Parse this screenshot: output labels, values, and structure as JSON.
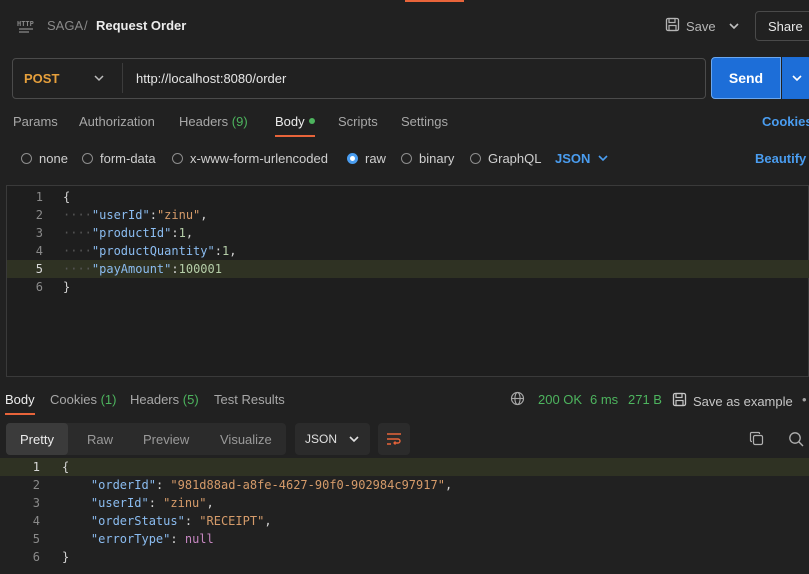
{
  "header": {
    "breadcrumb_parent": "SAGA",
    "breadcrumb_sep": "/",
    "title": "Request Order",
    "save_label": "Save",
    "share_label": "Share"
  },
  "request": {
    "method": "POST",
    "url": "http://localhost:8080/order",
    "send_label": "Send"
  },
  "request_tabs": {
    "params": "Params",
    "authorization": "Authorization",
    "headers": "Headers",
    "headers_count": "(9)",
    "body": "Body",
    "scripts": "Scripts",
    "settings": "Settings",
    "cookies": "Cookies"
  },
  "body_types": {
    "none": "none",
    "form_data": "form-data",
    "urlencoded": "x-www-form-urlencoded",
    "raw": "raw",
    "binary": "binary",
    "graphql": "GraphQL",
    "format": "JSON",
    "beautify": "Beautify",
    "selected": "raw"
  },
  "request_body": {
    "line_numbers": [
      "1",
      "2",
      "3",
      "4",
      "5",
      "6"
    ],
    "key_userId": "\"userId\"",
    "val_userId": "\"zinu\"",
    "key_productId": "\"productId\"",
    "val_productId": "1",
    "key_productQuantity": "\"productQuantity\"",
    "val_productQuantity": "1",
    "key_payAmount": "\"payAmount\"",
    "val_payAmount": "100001"
  },
  "response_tabs": {
    "body": "Body",
    "cookies": "Cookies",
    "cookies_count": "(1)",
    "headers": "Headers",
    "headers_count": "(5)",
    "tests": "Test Results"
  },
  "response_status": {
    "status": "200 OK",
    "time": "6 ms",
    "size": "271 B",
    "save_example": "Save as example"
  },
  "response_view": {
    "pretty": "Pretty",
    "raw": "Raw",
    "preview": "Preview",
    "visualize": "Visualize",
    "format": "JSON"
  },
  "response_body": {
    "line_numbers": [
      "1",
      "2",
      "3",
      "4",
      "5",
      "6"
    ],
    "key_orderId": "\"orderId\"",
    "val_orderId": "\"981d88ad-a8fe-4627-90f0-902984c97917\"",
    "key_userId": "\"userId\"",
    "val_userId": "\"zinu\"",
    "key_orderStatus": "\"orderStatus\"",
    "val_orderStatus": "\"RECEIPT\"",
    "key_errorType": "\"errorType\"",
    "val_errorType": "null"
  },
  "colors": {
    "accent_orange": "#e8643a",
    "send_blue": "#1d6ed8",
    "link_blue": "#4a9df0",
    "status_green": "#4db45e",
    "method_post": "#e7a03c"
  }
}
